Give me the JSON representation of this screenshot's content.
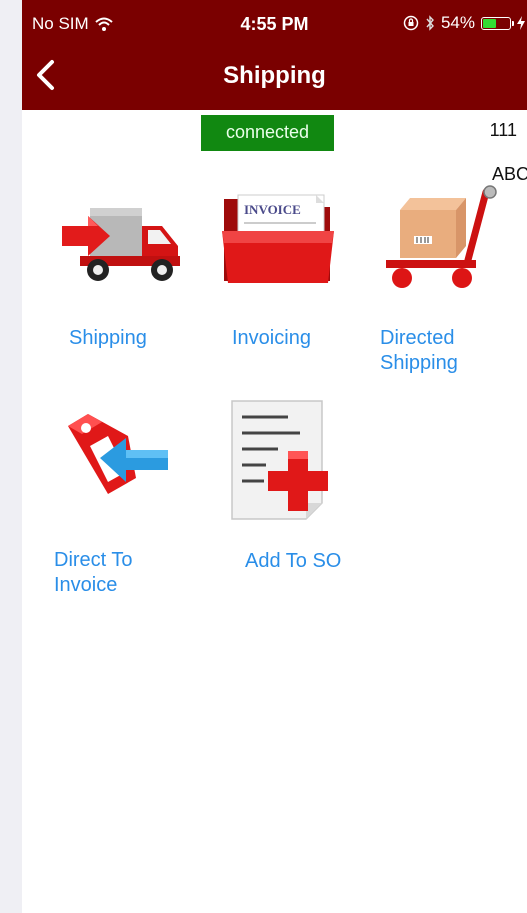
{
  "status_bar": {
    "carrier": "No SIM",
    "time": "4:55 PM",
    "battery": "54%",
    "battery_level": 0.54
  },
  "nav": {
    "title": "Shipping"
  },
  "connection": {
    "label": "connected",
    "color": "#118811"
  },
  "counter": "111",
  "abc_label": "ABC",
  "tiles": [
    {
      "label": "Shipping",
      "icon": "delivery-truck-icon"
    },
    {
      "label": "Invoicing",
      "icon": "invoice-folder-icon",
      "icon_text": "INVOICE"
    },
    {
      "label": "Directed Shipping",
      "icon": "hand-truck-icon"
    },
    {
      "label": "Direct To Invoice",
      "icon": "tag-arrow-icon"
    },
    {
      "label": "Add To SO",
      "icon": "add-document-icon"
    }
  ],
  "colors": {
    "header": "#7a0000",
    "link": "#2a8ee8",
    "icon_red": "#d41414"
  }
}
